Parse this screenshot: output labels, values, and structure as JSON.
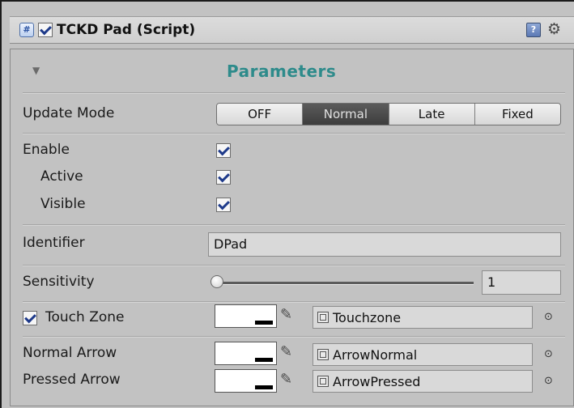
{
  "header": {
    "title": "TCKD Pad (Script)",
    "enabled": true,
    "script_icon": "script-icon",
    "reference_icon": "help-book-icon",
    "settings_icon": "gear-icon"
  },
  "section": {
    "title": "Parameters",
    "foldout_icon": "foldout-triangle-icon",
    "title_color": "#2e8b8b"
  },
  "update_mode": {
    "label": "Update Mode",
    "options": [
      "OFF",
      "Normal",
      "Late",
      "Fixed"
    ],
    "selected": "Normal"
  },
  "enable": {
    "label": "Enable",
    "checked": true
  },
  "active": {
    "label": "Active",
    "checked": true
  },
  "visible": {
    "label": "Visible",
    "checked": true
  },
  "identifier": {
    "label": "Identifier",
    "value": "DPad"
  },
  "sensitivity": {
    "label": "Sensitivity",
    "value": "1",
    "slider_fraction": 0.0
  },
  "touch_zone": {
    "label": "Touch Zone",
    "checked": true,
    "color": "#ffffff",
    "texture": "Touchzone"
  },
  "normal_arrow": {
    "label": "Normal Arrow",
    "color": "#ffffff",
    "texture": "ArrowNormal"
  },
  "pressed_arrow": {
    "label": "Pressed Arrow",
    "color": "#ffffff",
    "texture": "ArrowPressed"
  },
  "icons": {
    "color_picker": "eyedropper-icon",
    "texture": "texture-icon",
    "object_picker": "object-picker-target-icon"
  }
}
